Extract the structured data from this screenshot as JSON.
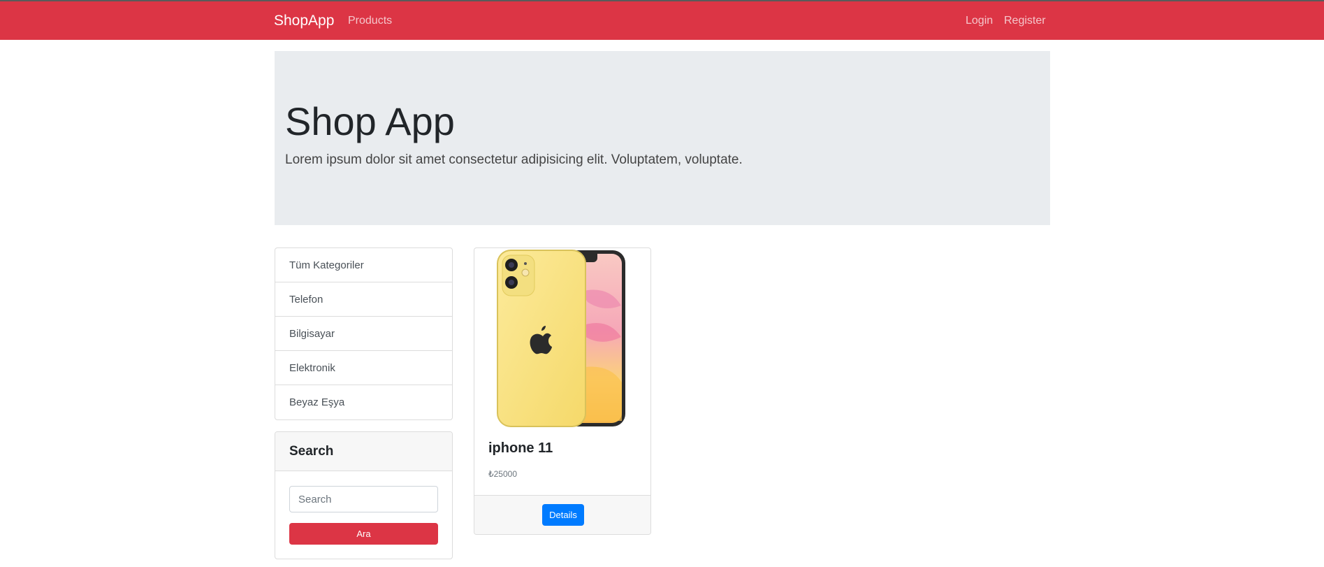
{
  "navbar": {
    "brand": "ShopApp",
    "products": "Products",
    "login": "Login",
    "register": "Register",
    "color": "#dc3545"
  },
  "jumbotron": {
    "title": "Shop App",
    "lead": "Lorem ipsum dolor sit amet consectetur adipisicing elit. Voluptatem, voluptate."
  },
  "categories": [
    {
      "label": "Tüm Kategoriler"
    },
    {
      "label": "Telefon"
    },
    {
      "label": "Bilgisayar"
    },
    {
      "label": "Elektronik"
    },
    {
      "label": "Beyaz Eşya"
    }
  ],
  "search": {
    "title": "Search",
    "placeholder": "Search",
    "button": "Ara"
  },
  "product": {
    "name": "iphone 11",
    "price": "₺25000",
    "details_button": "Details",
    "image": "iphone-11-yellow-image"
  }
}
